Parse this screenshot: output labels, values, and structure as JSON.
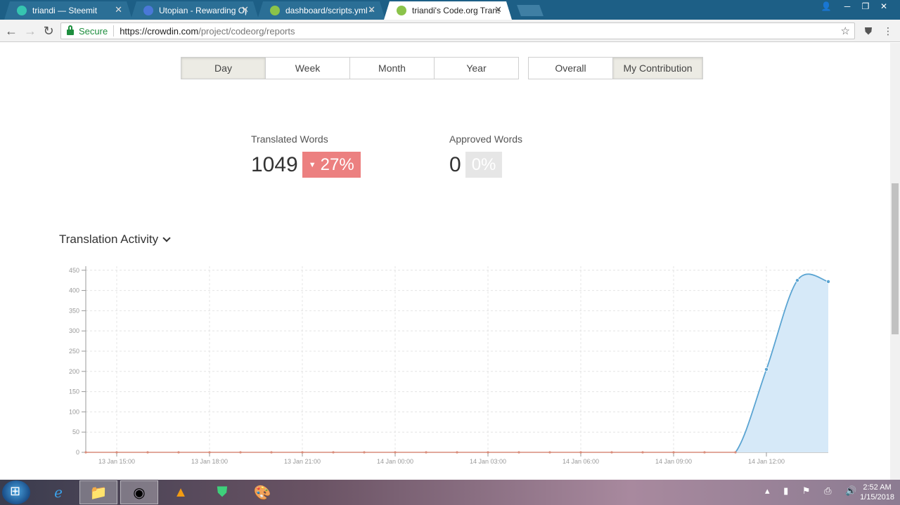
{
  "browser": {
    "tabs": [
      {
        "title": "triandi — Steemit",
        "color": "#36c5b0"
      },
      {
        "title": "Utopian - Rewarding Op",
        "color": "#4a78d8"
      },
      {
        "title": "dashboard/scripts.yml - (",
        "color": "#8bc34a"
      },
      {
        "title": "triandi's Code.org Transl",
        "color": "#8bc34a"
      }
    ],
    "secure_label": "Secure",
    "url_host": "https://crowdin.com",
    "url_path": "/project/codeorg/reports"
  },
  "period_buttons": [
    "Day",
    "Week",
    "Month",
    "Year"
  ],
  "scope_buttons": [
    "Overall",
    "My Contribution"
  ],
  "stats": {
    "translated": {
      "label": "Translated Words",
      "value": "1049",
      "change": "27%"
    },
    "approved": {
      "label": "Approved Words",
      "value": "0",
      "change": "0%"
    }
  },
  "section_title": "Translation Activity",
  "chart_data": {
    "type": "area",
    "x": [
      "13 Jan 14:00",
      "13 Jan 15:00",
      "13 Jan 16:00",
      "13 Jan 17:00",
      "13 Jan 18:00",
      "13 Jan 19:00",
      "13 Jan 20:00",
      "13 Jan 21:00",
      "13 Jan 22:00",
      "13 Jan 23:00",
      "14 Jan 00:00",
      "14 Jan 01:00",
      "14 Jan 02:00",
      "14 Jan 03:00",
      "14 Jan 04:00",
      "14 Jan 05:00",
      "14 Jan 06:00",
      "14 Jan 07:00",
      "14 Jan 08:00",
      "14 Jan 09:00",
      "14 Jan 10:00",
      "14 Jan 11:00",
      "14 Jan 12:00",
      "14 Jan 13:00",
      "14 Jan 14:00"
    ],
    "values": [
      0,
      0,
      0,
      0,
      0,
      0,
      0,
      0,
      0,
      0,
      0,
      0,
      0,
      0,
      0,
      0,
      0,
      0,
      0,
      0,
      0,
      0,
      205,
      425,
      422
    ],
    "x_ticks": [
      "13 Jan 15:00",
      "13 Jan 18:00",
      "13 Jan 21:00",
      "14 Jan 00:00",
      "14 Jan 03:00",
      "14 Jan 06:00",
      "14 Jan 09:00",
      "14 Jan 12:00"
    ],
    "y_ticks": [
      0,
      50,
      100,
      150,
      200,
      250,
      300,
      350,
      400,
      450
    ],
    "ylim": [
      0,
      460
    ],
    "grid": true,
    "line_color": "#5aa4d2",
    "fill_color": "#d6e9f8"
  },
  "taskbar": {
    "time": "2:52 AM",
    "date": "1/15/2018"
  }
}
